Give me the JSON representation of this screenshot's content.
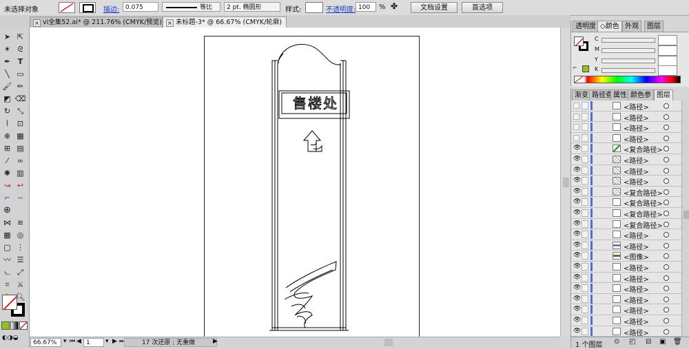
{
  "control_bar": {
    "selection_label": "未选择对象",
    "stroke_label": "描边:",
    "stroke_weight": "0.075",
    "stroke_profile": "等比",
    "brush_definition": "2 pt. 椭圆形",
    "style_label": "样式:",
    "opacity_label": "不透明度:",
    "opacity_value": "100",
    "opacity_unit": "%",
    "doc_setup_button": "文档设置",
    "preferences_button": "首选项"
  },
  "tabs": [
    {
      "label": "vi全集52.ai* @ 211.76% (CMYK/预览)",
      "active": false
    },
    {
      "label": "未标题-3* @ 66.67% (CMYK/轮廓)",
      "active": true
    }
  ],
  "canvas": {
    "sign_text": "售楼处"
  },
  "status_bar": {
    "zoom": "66.67%",
    "page": "1",
    "status_text": "17 次还原 ; 无重做"
  },
  "color_panel": {
    "tabs": [
      "透明度",
      "颜色",
      "外观",
      "图层"
    ],
    "channels": [
      "C",
      "M",
      "Y",
      "K"
    ],
    "colors": {
      "red_none": "#d42a2a",
      "green_swatch": "#8fc31f"
    }
  },
  "layers_panel": {
    "tabs": [
      "渐变",
      "路径查",
      "属性",
      "颜色参",
      "图层"
    ],
    "footer_label": "1 个图层",
    "rows": [
      {
        "label": "<路径>",
        "eye": false,
        "thumb": "white"
      },
      {
        "label": "<路径>",
        "eye": false,
        "thumb": "white"
      },
      {
        "label": "<路径>",
        "eye": false,
        "thumb": "white"
      },
      {
        "label": "<路径>",
        "eye": false,
        "thumb": "white"
      },
      {
        "label": "<复合路径>",
        "eye": true,
        "thumb": "green"
      },
      {
        "label": "<路径>",
        "eye": true,
        "thumb": "dots"
      },
      {
        "label": "<路径>",
        "eye": true,
        "thumb": "dots"
      },
      {
        "label": "<路径>",
        "eye": true,
        "thumb": "dots"
      },
      {
        "label": "<复合路径>",
        "eye": true,
        "thumb": "dots"
      },
      {
        "label": "<复合路径>",
        "eye": true,
        "thumb": "white"
      },
      {
        "label": "<复合路径>",
        "eye": true,
        "thumb": "white"
      },
      {
        "label": "<复合路径>",
        "eye": true,
        "thumb": "white"
      },
      {
        "label": "<路径>",
        "eye": true,
        "thumb": "white"
      },
      {
        "label": "<路径>",
        "eye": true,
        "thumb": "blue"
      },
      {
        "label": "<图像>",
        "eye": true,
        "thumb": "olive"
      },
      {
        "label": "<路径>",
        "eye": true,
        "thumb": "white"
      },
      {
        "label": "<路径>",
        "eye": true,
        "thumb": "white"
      },
      {
        "label": "<路径>",
        "eye": true,
        "thumb": "white"
      },
      {
        "label": "<路径>",
        "eye": true,
        "thumb": "white"
      },
      {
        "label": "<路径>",
        "eye": true,
        "thumb": "white"
      },
      {
        "label": "<路径>",
        "eye": true,
        "thumb": "white"
      },
      {
        "label": "<路径>",
        "eye": true,
        "thumb": "white"
      }
    ]
  }
}
